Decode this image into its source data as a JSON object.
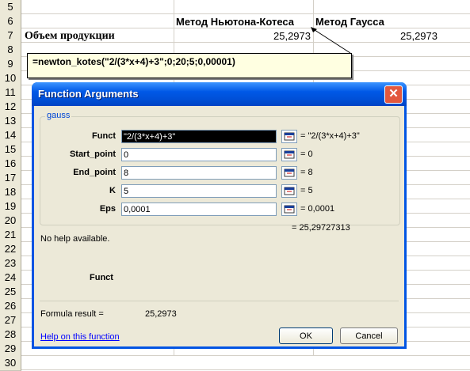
{
  "sheet": {
    "row_numbers": [
      "5",
      "6",
      "7",
      "8",
      "9",
      "10",
      "11",
      "12",
      "13",
      "14",
      "15",
      "16",
      "17",
      "18",
      "19",
      "20",
      "21",
      "22",
      "23",
      "24",
      "25",
      "26",
      "27",
      "28",
      "29",
      "30"
    ],
    "header_newton": "Метод Ньютона-Котеса",
    "header_gauss": "Метод Гаусса",
    "row7_label": "Объем продукции",
    "row7_newton": "25,2973",
    "row7_gauss": "25,2973"
  },
  "comment": {
    "text": "=newton_kotes(\"2/(3*x+4)+3\";0;20;5;0,00001)"
  },
  "dialog": {
    "title": "Function Arguments",
    "close_glyph": "✕",
    "function_name": "gauss",
    "args": [
      {
        "label": "Funct",
        "value": "\"2/(3*x+4)+3\"",
        "result": "= \"2/(3*x+4)+3\""
      },
      {
        "label": "Start_point",
        "value": "0",
        "result": "= 0"
      },
      {
        "label": "End_point",
        "value": "8",
        "result": "= 8"
      },
      {
        "label": "K",
        "value": "5",
        "result": "= 5"
      },
      {
        "label": "Eps",
        "value": "0,0001",
        "result": "= 0,0001"
      }
    ],
    "total_result": "= 25,29727313",
    "help_text": "No help available.",
    "arg_desc_name": "Funct",
    "formula_result_label": "Formula result =",
    "formula_result_value": "25,2973",
    "help_link": "Help on this function",
    "ok_label": "OK",
    "cancel_label": "Cancel"
  },
  "colors": {
    "titlebar": "#0054e3",
    "accent_label": "#0046d5",
    "link": "#0000ff",
    "comment_bg": "#ffffe1"
  },
  "icons": [
    "collapse-dialog-icon",
    "close-icon"
  ]
}
